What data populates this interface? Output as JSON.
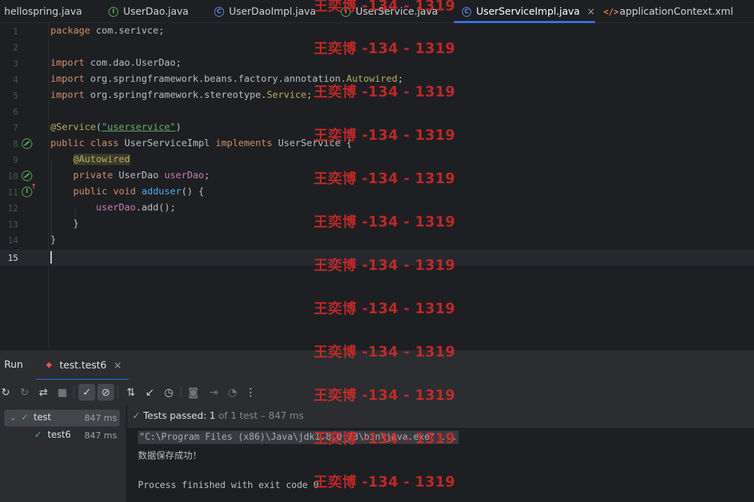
{
  "tabs": [
    {
      "label": "hellospring.java",
      "icon": "java-file-icon"
    },
    {
      "label": "UserDao.java",
      "icon": "interface-icon"
    },
    {
      "label": "UserDaoImpl.java",
      "icon": "class-icon"
    },
    {
      "label": "UserService.java",
      "icon": "interface-icon"
    },
    {
      "label": "UserServiceImpl.java",
      "icon": "class-icon",
      "active": true,
      "close": "×"
    },
    {
      "label": "applicationContext.xml",
      "icon": "xml-icon"
    }
  ],
  "editor": {
    "line_numbers": [
      "1",
      "2",
      "3",
      "4",
      "5",
      "6",
      "7",
      "8",
      "9",
      "10",
      "11",
      "12",
      "13",
      "14",
      "15"
    ],
    "current_line": "15",
    "lines": {
      "l1": {
        "kw": "package",
        "rest": " com.serivce;"
      },
      "l3": {
        "kw": "import",
        "rest": " com.dao.UserDao;"
      },
      "l4": {
        "kw": "import",
        "rest": " org.springframework.beans.factory.annotation.",
        "ann": "Autowired",
        "end": ";"
      },
      "l5": {
        "kw": "import",
        "rest": " org.springframework.stereotype.",
        "ann": "Service",
        "end": ";"
      },
      "l7": {
        "ann": "@Service",
        "open": "(",
        "str": "\"userservice\"",
        "close": ")"
      },
      "l8": {
        "kw1": "public",
        "kw2": "class",
        "name": " UserServiceImpl ",
        "kw3": "implements",
        "rest": " UserService {"
      },
      "l9": {
        "ann": "@Autowired"
      },
      "l10": {
        "kw": "private",
        "type": " UserDao ",
        "fld": "userDao",
        "end": ";"
      },
      "l11": {
        "kw1": "public",
        "kw2": "void",
        "fn": "adduser",
        "rest": "() {"
      },
      "l12": {
        "fld": "userDao",
        "rest": ".add();"
      },
      "l13": {
        "rest": "}"
      },
      "l14": {
        "rest": "}"
      }
    }
  },
  "run": {
    "title": "Run",
    "tab_label": "test.test6",
    "tab_close": "×",
    "status": {
      "prefix": "Tests passed: ",
      "count": "1",
      "suffix": " of 1 test – 847 ms"
    },
    "tree": [
      {
        "label": "test",
        "duration": "847 ms"
      },
      {
        "label": "test6",
        "duration": "847 ms"
      }
    ],
    "console": {
      "command": "\"C:\\Program Files (x86)\\Java\\jdk1.8.0_73\\bin\\java.exe\" ...",
      "output": "数据保存成功！",
      "exit": "Process finished with exit code 0"
    }
  },
  "watermark": "王奕博 -134 - 1319",
  "colors": {
    "accent": "#3574f0",
    "pass": "#5fb865",
    "keyword": "#cf8e6d",
    "annotation": "#b3ae60",
    "string": "#6aab73",
    "field": "#c77dbb",
    "method": "#56a8f5",
    "watermark": "#e02b2b"
  }
}
